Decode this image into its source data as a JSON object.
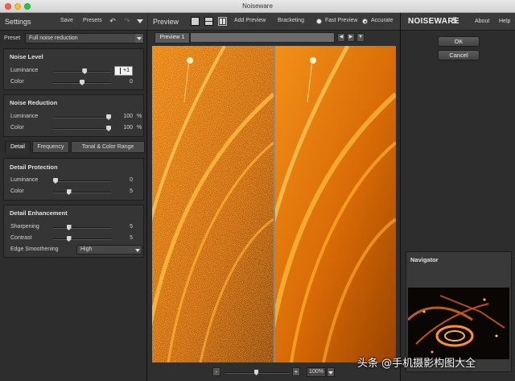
{
  "window": {
    "title": "Noiseware"
  },
  "settings": {
    "title": "Settings",
    "save_label": "Save",
    "presets_label": "Presets",
    "preset_label": "Preset",
    "preset_value": "Full noise reduction"
  },
  "noise_level": {
    "title": "Noise Level",
    "luminance": {
      "label": "Luminance",
      "value": "+1",
      "level": 0.55
    },
    "color": {
      "label": "Color",
      "value": "0",
      "level": 0.5
    }
  },
  "noise_reduction": {
    "title": "Noise Reduction",
    "luminance": {
      "label": "Luminance",
      "value": "100",
      "unit": "%",
      "level": 1.0
    },
    "color": {
      "label": "Color",
      "value": "100",
      "unit": "%",
      "level": 1.0
    }
  },
  "tabs": [
    "Detail",
    "Frequency",
    "Tonal & Color Range"
  ],
  "detail_protection": {
    "title": "Detail Protection",
    "luminance": {
      "label": "Luminance",
      "value": "0",
      "level": 0.0
    },
    "color": {
      "label": "Color",
      "value": "5",
      "level": 0.25
    }
  },
  "detail_enhancement": {
    "title": "Detail Enhancement",
    "sharpening": {
      "label": "Sharpening",
      "value": "5",
      "level": 0.25
    },
    "contrast": {
      "label": "Contrast",
      "value": "5",
      "level": 0.25
    },
    "edge_smoothening": {
      "label": "Edge Smoothening",
      "value": "High"
    }
  },
  "preview": {
    "title": "Preview",
    "add_preview_label": "Add Preview",
    "bracketing_label": "Bracketing",
    "fast_preview_label": "Fast Preview",
    "accurate_label": "Accurate",
    "tab_label": "Preview 1",
    "zoom_minus": "-",
    "zoom_plus": "+",
    "zoom_value": "100%",
    "zoom_level": 0.48
  },
  "right": {
    "logo_text": "NOISEWARE",
    "logo_version": "5",
    "about_label": "About",
    "help_label": "Help",
    "ok_label": "OK",
    "cancel_label": "Cancel",
    "navigator_title": "Navigator"
  },
  "watermark": {
    "text": "头条 @手机摄影构图大全"
  },
  "colors": {
    "panel": "#2d2d2d",
    "header": "#3a3a3a",
    "accent_orange": "#f08a10"
  }
}
